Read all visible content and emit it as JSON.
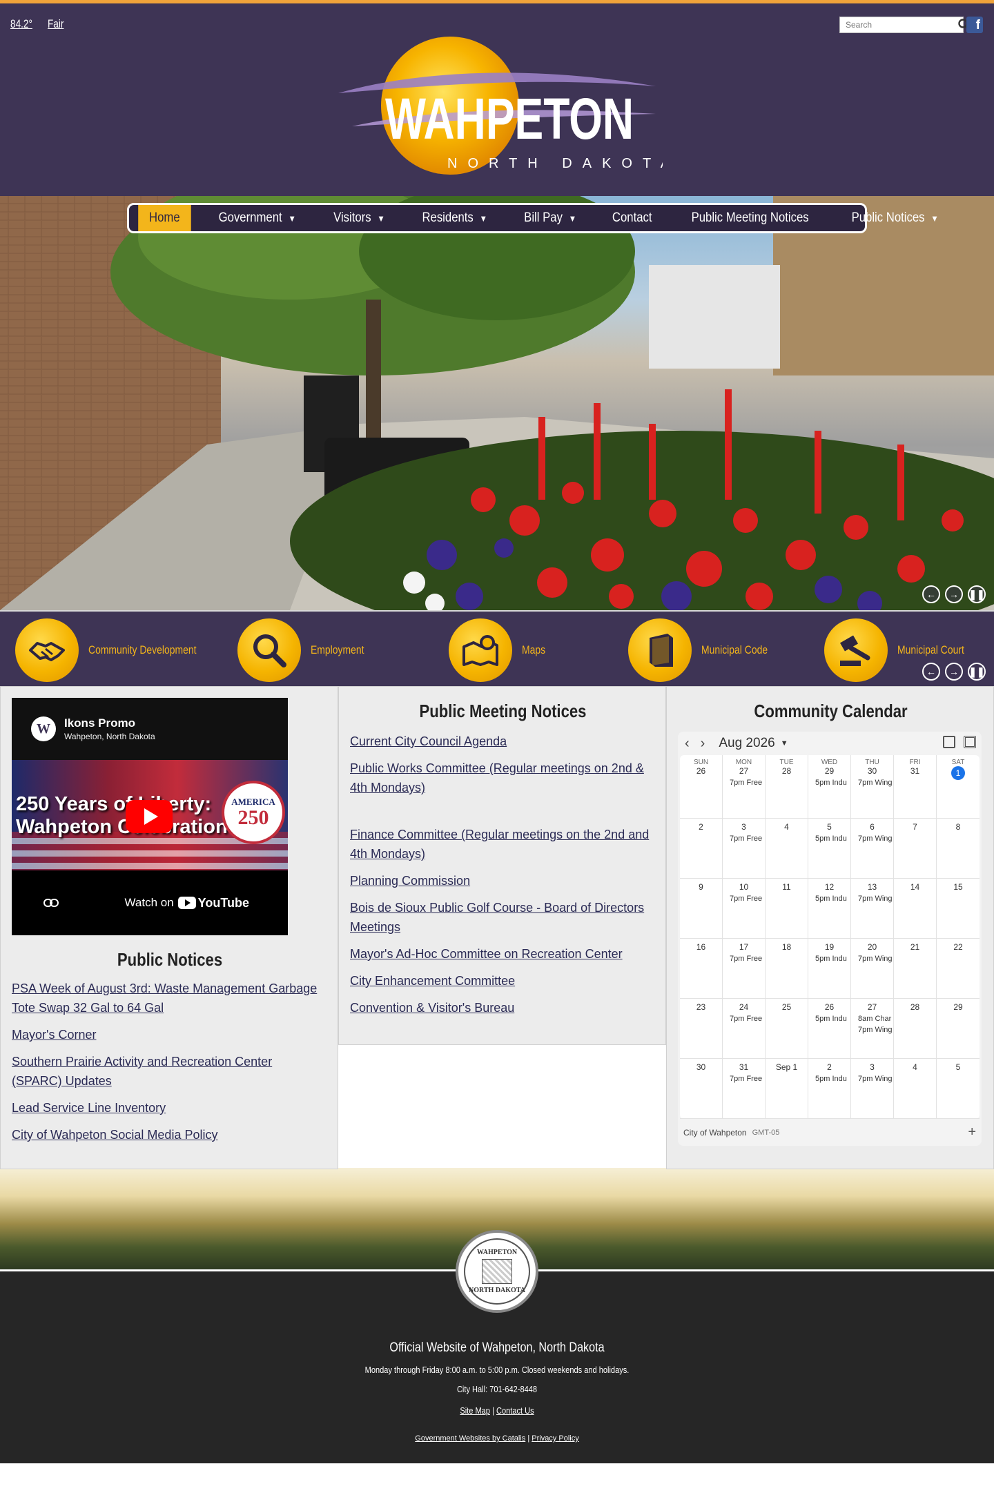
{
  "weather": {
    "temp": "84.2°",
    "condition": "Fair"
  },
  "search": {
    "placeholder": "Search"
  },
  "logo": {
    "name": "WAHPETON",
    "sub": "NORTH DAKOTA"
  },
  "nav": {
    "items": [
      {
        "label": "Home",
        "caret": ""
      },
      {
        "label": "Government",
        "caret": "▼"
      },
      {
        "label": "Visitors",
        "caret": "▼"
      },
      {
        "label": "Residents",
        "caret": "▼"
      },
      {
        "label": "Bill Pay",
        "caret": "▼"
      },
      {
        "label": "Contact",
        "caret": ""
      },
      {
        "label": "Public Meeting Notices",
        "caret": ""
      },
      {
        "label": "Public Notices",
        "caret": "▼"
      }
    ]
  },
  "quicklinks": [
    {
      "label": "Community Development",
      "icon": "handshake-icon"
    },
    {
      "label": "Employment",
      "icon": "magnifier-icon"
    },
    {
      "label": "Maps",
      "icon": "map-pin-icon"
    },
    {
      "label": "Municipal Code",
      "icon": "book-icon"
    },
    {
      "label": "Municipal Court",
      "icon": "gavel-icon"
    }
  ],
  "video": {
    "channel_initial": "W",
    "channel": "Ikons Promo",
    "location": "Wahpeton, North Dakota",
    "title_line1": "250 Years of Liberty:",
    "title_line2": "Wahpeton Celebration",
    "badge_top": "AMERICA",
    "badge_num": "250",
    "watch_on": "Watch on",
    "youtube": "YouTube"
  },
  "public_notices": {
    "title": "Public Notices",
    "links": [
      "PSA Week of August 3rd: Waste Management Garbage Tote Swap 32 Gal to 64 Gal",
      "Mayor's Corner",
      "Southern Prairie Activity and Recreation Center (SPARC) Updates",
      "Lead Service Line Inventory",
      "City of Wahpeton Social Media Policy"
    ]
  },
  "public_meeting_notices": {
    "title": "Public Meeting Notices",
    "links": [
      "Current City Council Agenda",
      "Public Works Committee (Regular meetings on 2nd & 4th Mondays)",
      "Finance Committee (Regular meetings on the 2nd and 4th Mondays)",
      "Planning Commission",
      "Bois de Sioux Public Golf Course - Board of Directors Meetings",
      "Mayor's Ad-Hoc Committee on Recreation Center",
      "City Enhancement Committee",
      "Convention & Visitor's Bureau"
    ]
  },
  "calendar": {
    "title": "Community Calendar",
    "month": "Aug 2026",
    "days_of_week": [
      "SUN",
      "MON",
      "TUE",
      "WED",
      "THU",
      "FRI",
      "SAT"
    ],
    "weeks": [
      [
        {
          "d": "26",
          "e": []
        },
        {
          "d": "27",
          "e": [
            "7pm Free"
          ]
        },
        {
          "d": "28",
          "e": []
        },
        {
          "d": "29",
          "e": [
            "5pm Indu"
          ]
        },
        {
          "d": "30",
          "e": [
            "7pm Wing"
          ]
        },
        {
          "d": "31",
          "e": []
        },
        {
          "d": "1",
          "e": [],
          "today": true
        }
      ],
      [
        {
          "d": "2",
          "e": []
        },
        {
          "d": "3",
          "e": [
            "7pm Free"
          ]
        },
        {
          "d": "4",
          "e": []
        },
        {
          "d": "5",
          "e": [
            "5pm Indu"
          ]
        },
        {
          "d": "6",
          "e": [
            "7pm Wing"
          ]
        },
        {
          "d": "7",
          "e": []
        },
        {
          "d": "8",
          "e": []
        }
      ],
      [
        {
          "d": "9",
          "e": []
        },
        {
          "d": "10",
          "e": [
            "7pm Free"
          ]
        },
        {
          "d": "11",
          "e": []
        },
        {
          "d": "12",
          "e": [
            "5pm Indu"
          ]
        },
        {
          "d": "13",
          "e": [
            "7pm Wing"
          ]
        },
        {
          "d": "14",
          "e": []
        },
        {
          "d": "15",
          "e": []
        }
      ],
      [
        {
          "d": "16",
          "e": []
        },
        {
          "d": "17",
          "e": [
            "7pm Free"
          ]
        },
        {
          "d": "18",
          "e": []
        },
        {
          "d": "19",
          "e": [
            "5pm Indu"
          ]
        },
        {
          "d": "20",
          "e": [
            "7pm Wing"
          ]
        },
        {
          "d": "21",
          "e": []
        },
        {
          "d": "22",
          "e": []
        }
      ],
      [
        {
          "d": "23",
          "e": []
        },
        {
          "d": "24",
          "e": [
            "7pm Free"
          ]
        },
        {
          "d": "25",
          "e": []
        },
        {
          "d": "26",
          "e": [
            "5pm Indu"
          ]
        },
        {
          "d": "27",
          "e": [
            "8am Char",
            "7pm Wing"
          ]
        },
        {
          "d": "28",
          "e": []
        },
        {
          "d": "29",
          "e": []
        }
      ],
      [
        {
          "d": "30",
          "e": []
        },
        {
          "d": "31",
          "e": [
            "7pm Free"
          ]
        },
        {
          "d": "Sep 1",
          "e": []
        },
        {
          "d": "2",
          "e": [
            "5pm Indu"
          ]
        },
        {
          "d": "3",
          "e": [
            "7pm Wing"
          ]
        },
        {
          "d": "4",
          "e": []
        },
        {
          "d": "5",
          "e": []
        }
      ]
    ],
    "calendar_name": "City of Wahpeton",
    "timezone": "GMT-05"
  },
  "footer": {
    "seal_top": "WAHPETON",
    "seal_bottom": "NORTH DAKOTA",
    "title": "Official Website of Wahpeton, North Dakota",
    "hours": "Monday through Friday 8:00 a.m. to 5:00 p.m. Closed weekends and holidays.",
    "phone": "City Hall: 701-642-8448",
    "site_map": "Site Map",
    "separator": "|",
    "contact_us": "Contact Us",
    "credit": "Government Websites by Catalis",
    "privacy": "Privacy Policy"
  },
  "colors": {
    "header_bg": "#3e3455",
    "accent_gold": "#f3b51b",
    "footer_bg": "#262626"
  }
}
